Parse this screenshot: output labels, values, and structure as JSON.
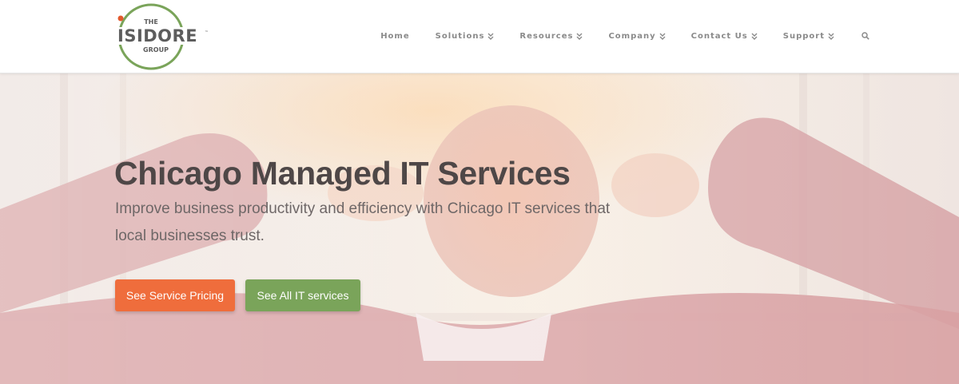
{
  "logo": {
    "top_text": "THE",
    "main_text": "ISIDORE",
    "bottom_text": "GROUP",
    "tm": "™"
  },
  "nav": {
    "items": [
      {
        "label": "Home",
        "has_dropdown": false
      },
      {
        "label": "Solutions",
        "has_dropdown": true
      },
      {
        "label": "Resources",
        "has_dropdown": true
      },
      {
        "label": "Company",
        "has_dropdown": true
      },
      {
        "label": "Contact Us",
        "has_dropdown": true
      },
      {
        "label": "Support",
        "has_dropdown": true
      }
    ],
    "search_icon": "search-icon"
  },
  "hero": {
    "title": "Chicago Managed IT Services",
    "subtitle": "Improve business productivity and efficiency with Chicago IT services that local businesses trust.",
    "buttons": {
      "pricing_label": "See Service Pricing",
      "services_label": "See All IT services"
    }
  },
  "colors": {
    "accent_orange": "#ef6d3c",
    "accent_green": "#7aa45a",
    "logo_green": "#7aa45a",
    "logo_dot": "#e3592d",
    "text_dark": "#4e4747",
    "nav_text": "#8a8a8a"
  }
}
